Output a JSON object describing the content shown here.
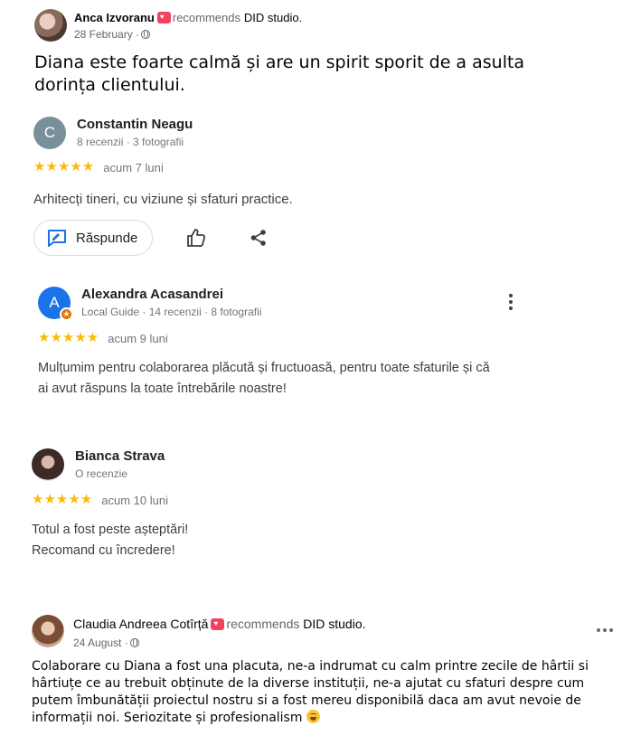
{
  "post1": {
    "author": "Anca Izvoranu",
    "recommends_text": "recommends",
    "page": "DID studio.",
    "date": "28 February ·",
    "text": "Diana este foarte calmă și are un spirit sporit de a asulta dorința clientului."
  },
  "review1": {
    "initial": "C",
    "avatar_color": "#78909c",
    "name": "Constantin Neagu",
    "meta": "8 recenzii · 3 fotografii",
    "stars": "★★★★★",
    "time": "acum 7 luni",
    "text": "Arhitecți tineri, cu viziune și sfaturi practice.",
    "reply_label": "Răspunde"
  },
  "review2": {
    "initial": "A",
    "avatar_color": "#1a73e8",
    "name": "Alexandra Acasandrei",
    "meta": "Local Guide · 14 recenzii · 8 fotografii",
    "stars": "★★★★★",
    "time": "acum 9 luni",
    "text_line1": "Mulțumim pentru colaborarea plăcută și fructuoasă, pentru toate sfaturile și că",
    "text_line2": "ai avut răspuns la toate întrebările noastre!"
  },
  "review3": {
    "name": "Bianca Strava",
    "meta": "O recenzie",
    "stars": "★★★★★",
    "time": "acum 10 luni",
    "text_line1": "Totul a fost peste așteptări!",
    "text_line2": "Recomand cu încredere!"
  },
  "post2": {
    "author": "Claudia Andreea Cotîrță",
    "recommends_text": "recommends",
    "page": "DID studio.",
    "date": "24 August ·",
    "text": "Colaborare cu Diana a fost una placuta, ne-a indrumat cu calm printre zecile de hârtii si hârtiuțe ce au trebuit obținute de la diverse instituții, ne-a ajutat cu sfaturi despre cum putem îmbunătății proiectul nostru si a fost mereu disponibilă daca am avut nevoie de informații noi. Seriozitate și profesionalism"
  },
  "colors": {
    "star": "#fbbc04",
    "fb_recommend": "#f3425f",
    "google_blue": "#1a73e8"
  }
}
